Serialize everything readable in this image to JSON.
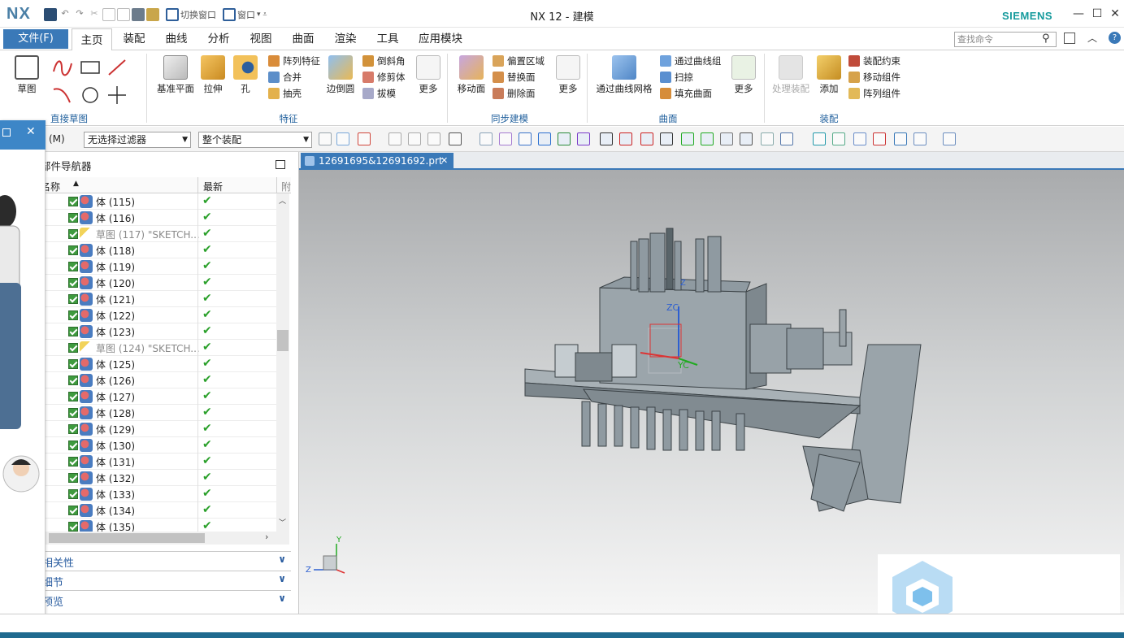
{
  "app": {
    "logo": "NX",
    "title": "NX 12 - 建模",
    "brand": "SIEMENS"
  },
  "quick_access": {
    "switch_window": "切换窗口",
    "window": "窗口"
  },
  "menu": {
    "file": "文件(F)",
    "tabs": [
      "主页",
      "装配",
      "曲线",
      "分析",
      "视图",
      "曲面",
      "渲染",
      "工具",
      "应用模块"
    ],
    "search_placeholder": "查找命令"
  },
  "ribbon": {
    "sketch": "草图",
    "groups": [
      "直接草图",
      "特征",
      "同步建模",
      "曲面",
      "装配"
    ],
    "feature": {
      "datum_plane": "基准平面",
      "extrude": "拉伸",
      "hole": "孔",
      "pattern_feature": "阵列特征",
      "unite": "合并",
      "shell": "抽壳",
      "edge_blend": "边倒圆",
      "chamfer": "倒斜角",
      "trim_body": "修剪体",
      "draft": "拔模",
      "more": "更多"
    },
    "sync": {
      "move_face": "移动面",
      "offset_region": "偏置区域",
      "replace_face": "替换面",
      "delete_face": "删除面",
      "more": "更多"
    },
    "surface": {
      "through_curve_mesh": "通过曲线网格",
      "through_curves": "通过曲线组",
      "swept": "扫掠",
      "fill_surface": "填充曲面",
      "more": "更多"
    },
    "assembly": {
      "process": "处理装配",
      "add": "添加",
      "constraint": "装配约束",
      "move_component": "移动组件",
      "pattern_component": "阵列组件"
    }
  },
  "toolbar": {
    "menu_label": "(M)",
    "filter": "无选择过滤器",
    "scope": "整个装配"
  },
  "navigator": {
    "title": "部件导航器",
    "col_name": "名称",
    "col_latest": "最新",
    "col_extra": "附",
    "rows": [
      {
        "label": "体 (115)",
        "type": "body"
      },
      {
        "label": "体 (116)",
        "type": "body"
      },
      {
        "label": "草图 (117) \"SKETCH...",
        "type": "sketch"
      },
      {
        "label": "体 (118)",
        "type": "body"
      },
      {
        "label": "体 (119)",
        "type": "body"
      },
      {
        "label": "体 (120)",
        "type": "body"
      },
      {
        "label": "体 (121)",
        "type": "body"
      },
      {
        "label": "体 (122)",
        "type": "body"
      },
      {
        "label": "体 (123)",
        "type": "body"
      },
      {
        "label": "草图 (124) \"SKETCH...",
        "type": "sketch"
      },
      {
        "label": "体 (125)",
        "type": "body"
      },
      {
        "label": "体 (126)",
        "type": "body"
      },
      {
        "label": "体 (127)",
        "type": "body"
      },
      {
        "label": "体 (128)",
        "type": "body"
      },
      {
        "label": "体 (129)",
        "type": "body"
      },
      {
        "label": "体 (130)",
        "type": "body"
      },
      {
        "label": "体 (131)",
        "type": "body"
      },
      {
        "label": "体 (132)",
        "type": "body"
      },
      {
        "label": "体 (133)",
        "type": "body"
      },
      {
        "label": "体 (134)",
        "type": "body"
      },
      {
        "label": "体 (135)",
        "type": "body"
      }
    ],
    "panels": [
      "相关性",
      "细节",
      "预览"
    ]
  },
  "document": {
    "tab_name": "12691695&12691692.prt"
  },
  "viewport": {
    "zc_label": "ZC",
    "yc_label": "YC",
    "z_label": "Z",
    "triad_z": "Z",
    "triad_y": "Y"
  },
  "colors": {
    "accent": "#3a79b8",
    "brand": "#159a9c",
    "ok": "#2aa02a",
    "model": "#8f9aa1"
  }
}
